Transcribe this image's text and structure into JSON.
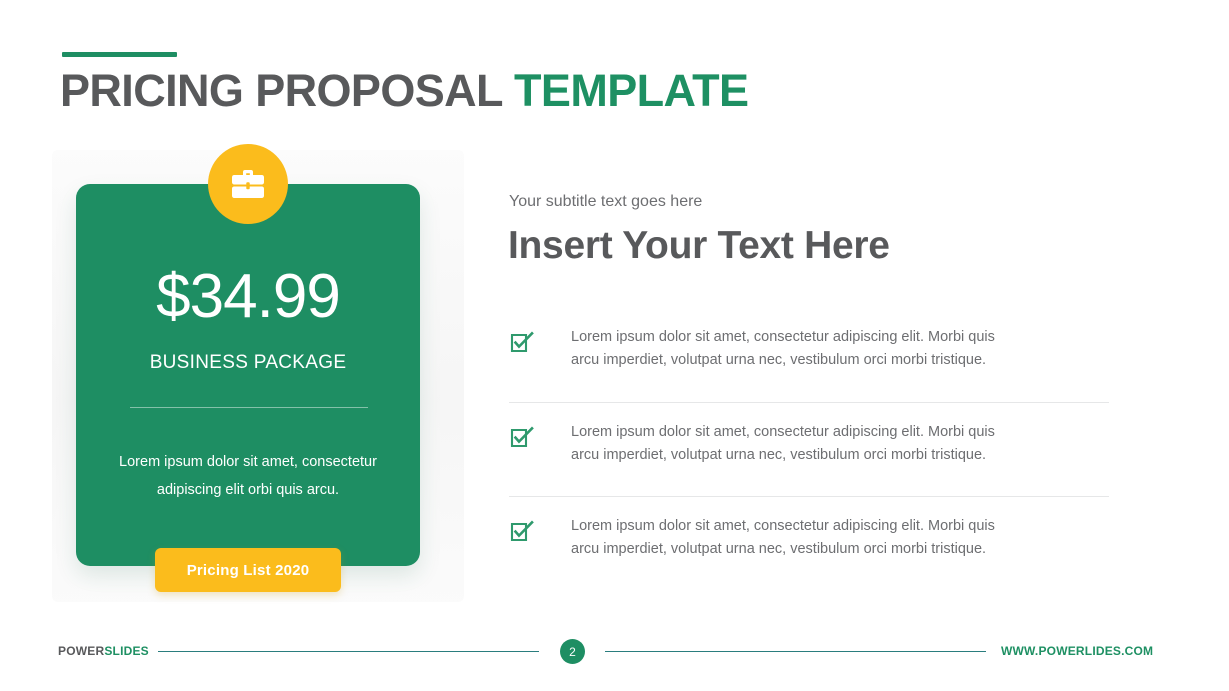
{
  "slide": {
    "title_main": "PRICING PROPOSAL ",
    "title_accent": "TEMPLATE"
  },
  "colors": {
    "green": "#1e8e63",
    "green_text": "#1e9063",
    "yellow": "#fbbc1c",
    "dark_gray": "#58595b",
    "body_gray": "#6d6e71",
    "footer_line": "#2a7d7e"
  },
  "pricing_card": {
    "icon": "briefcase-icon",
    "price": "$34.99",
    "package": "BUSINESS PACKAGE",
    "description": "Lorem ipsum dolor sit amet, consectetur adipiscing elit orbi quis arcu.",
    "cta_label": "Pricing List 2020"
  },
  "content": {
    "subtitle": "Your subtitle text goes here",
    "headline": "Insert Your Text Here",
    "features": [
      {
        "icon": "checkbox-checked-icon",
        "text": "Lorem ipsum dolor sit amet, consectetur adipiscing elit. Morbi quis arcu imperdiet, volutpat urna nec, vestibulum orci morbi tristique."
      },
      {
        "icon": "checkbox-checked-icon",
        "text": "Lorem ipsum dolor sit amet, consectetur adipiscing elit. Morbi quis arcu imperdiet, volutpat urna nec, vestibulum orci morbi tristique."
      },
      {
        "icon": "checkbox-checked-icon",
        "text": "Lorem ipsum dolor sit amet, consectetur adipiscing elit. Morbi quis arcu imperdiet, volutpat urna nec, vestibulum orci morbi tristique."
      }
    ]
  },
  "footer": {
    "brand_first": "POWER",
    "brand_second": "SLIDES",
    "page_number": "2",
    "url": "WWW.POWERLIDES.COM"
  }
}
